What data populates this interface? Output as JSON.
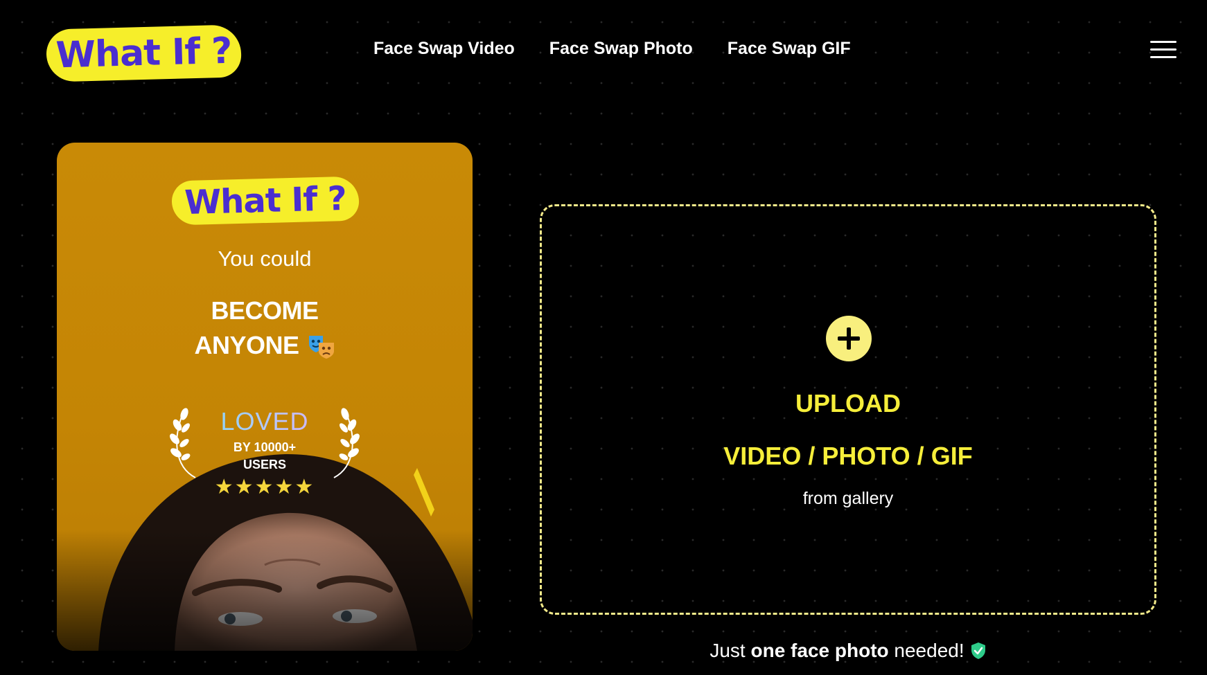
{
  "header": {
    "logo_text": "What If ?",
    "nav": [
      {
        "label": "Face Swap Video"
      },
      {
        "label": "Face Swap Photo"
      },
      {
        "label": "Face Swap GIF"
      }
    ]
  },
  "promo": {
    "logo_text": "What If ?",
    "subtitle": "You could",
    "headline_line1": "BECOME",
    "headline_line2": "ANYONE",
    "loved_title": "LOVED",
    "loved_by_line1": "BY 10000+",
    "loved_by_line2": "USERS",
    "rating_stars": 5,
    "stars_text": "★★★★★"
  },
  "upload": {
    "title": "UPLOAD",
    "types": "VIDEO / PHOTO / GIF",
    "source": "from gallery"
  },
  "footnote": {
    "prefix": "Just",
    "bold": "one face photo",
    "suffix": "needed!"
  },
  "colors": {
    "accent_yellow": "#f6ee2a",
    "logo_purple": "#4a2ed0",
    "card_orange": "#c98a06",
    "shield_green": "#2ecc8a"
  }
}
